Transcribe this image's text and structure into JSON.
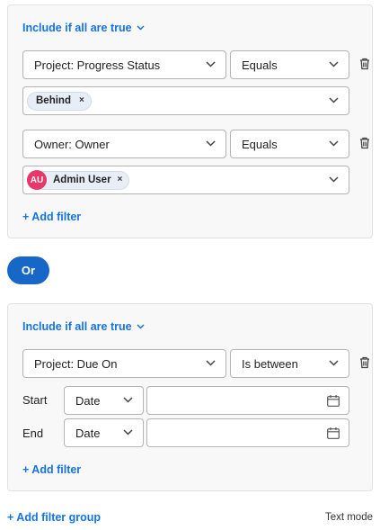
{
  "or_button": "Or",
  "groups": [
    {
      "include_label": "Include if all are true",
      "filters": [
        {
          "field": "Project: Progress Status",
          "operator": "Equals",
          "values": [
            {
              "label": "Behind"
            }
          ]
        },
        {
          "field": "Owner: Owner",
          "operator": "Equals",
          "values": [
            {
              "label": "Admin User",
              "initials": "AU"
            }
          ]
        }
      ],
      "add_filter": "+ Add filter"
    },
    {
      "include_label": "Include if all are true",
      "filters": [
        {
          "field": "Project: Due On",
          "operator": "Is between",
          "range": [
            {
              "label": "Start",
              "mode": "Date",
              "value": ""
            },
            {
              "label": "End",
              "mode": "Date",
              "value": ""
            }
          ]
        }
      ],
      "add_filter": "+ Add filter"
    }
  ],
  "footer": {
    "add_group": "+ Add filter group",
    "text_mode": "Text mode"
  },
  "colors": {
    "accent": "#1473e6",
    "or_button": "#1767c9",
    "avatar": "#e8386a"
  }
}
